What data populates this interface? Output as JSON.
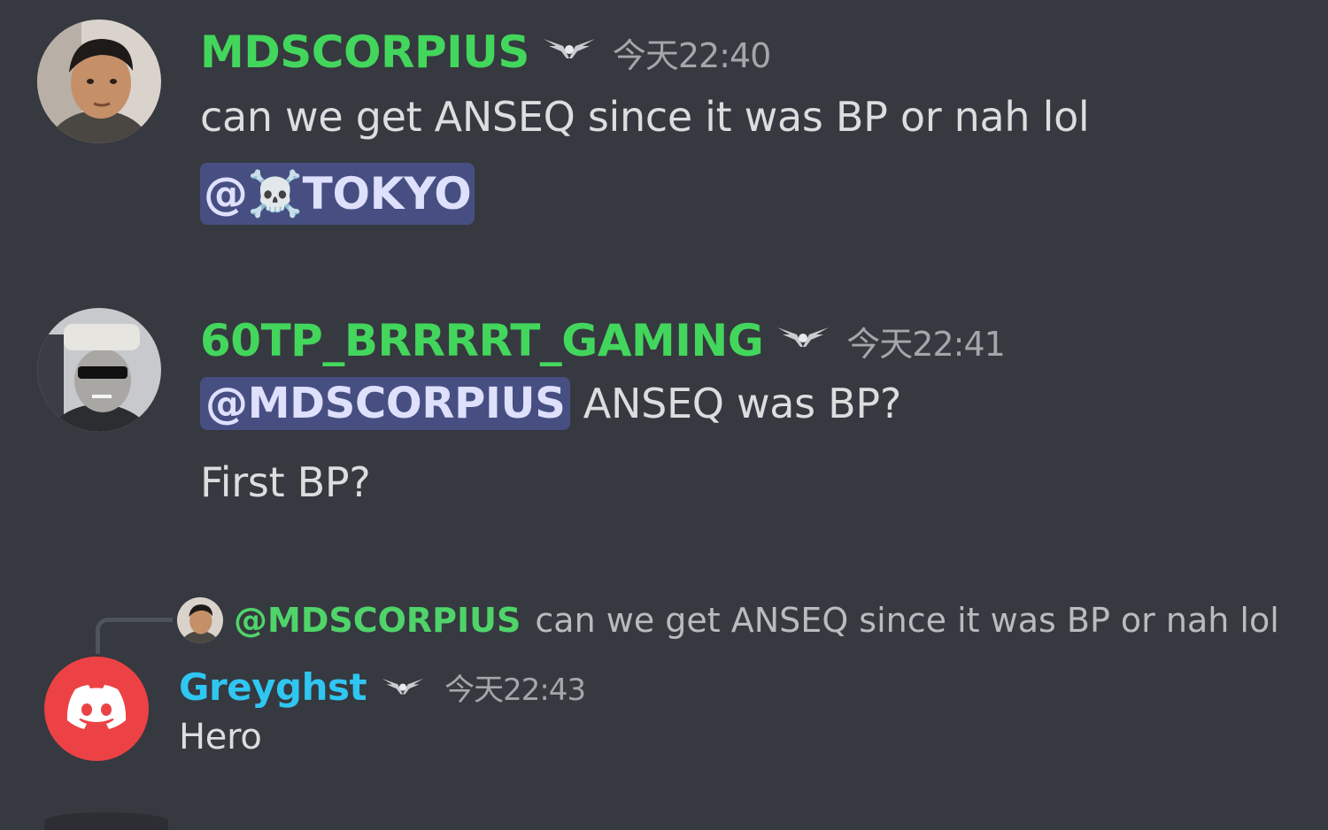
{
  "messages": [
    {
      "username": "MDSCORPIUS",
      "username_color": "#43d65c",
      "badge": "wings-badge",
      "timestamp": "今天22:40",
      "lines": [
        {
          "text": "can we get ANSEQ since it was BP or nah lol"
        },
        {
          "mention": "@☠️TOKYO"
        }
      ]
    },
    {
      "username": "60TP_BRRRRT_GAMING",
      "username_color": "#43d65c",
      "badge": "wings-badge",
      "timestamp": "今天22:41",
      "lines": [
        {
          "mention": "@MDSCORPIUS",
          "text": " ANSEQ was BP?"
        },
        {
          "text": "First BP?"
        }
      ]
    },
    {
      "reply_to": {
        "username": "@MDSCORPIUS",
        "username_color": "#43d65c",
        "text": "can we get ANSEQ since it was BP or nah lol"
      },
      "username": "Greyghst",
      "username_color": "#2fc6f2",
      "badge": "wings-badge",
      "timestamp": "今天22:43",
      "lines": [
        {
          "text": "Hero"
        }
      ],
      "avatar": "discord-logo-icon"
    }
  ],
  "colors": {
    "background": "#36393f",
    "mention_bg": "#474f82",
    "timestamp": "#a3a6aa",
    "discord_red": "#ed4245"
  }
}
